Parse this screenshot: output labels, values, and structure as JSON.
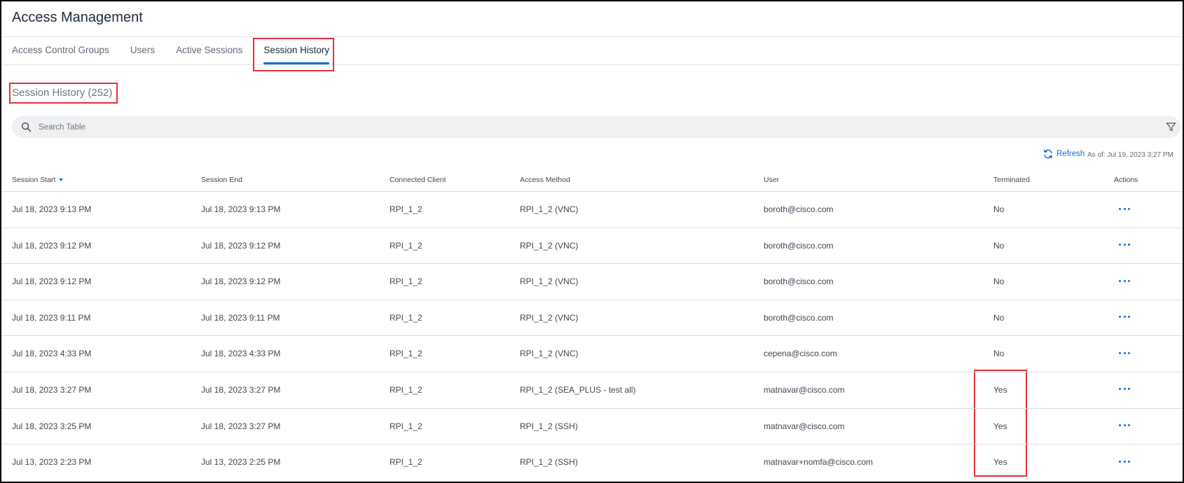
{
  "app": {
    "title": "Access Management"
  },
  "tabs": [
    {
      "label": "Access Control Groups",
      "active": false
    },
    {
      "label": "Users",
      "active": false
    },
    {
      "label": "Active Sessions",
      "active": false
    },
    {
      "label": "Session History",
      "active": true
    }
  ],
  "section": {
    "title": "Session History (252)"
  },
  "search": {
    "placeholder": "Search Table",
    "value": ""
  },
  "toolbar": {
    "refresh_label": "Refresh",
    "as_of": "As of: Jul 19, 2023 3:27 PM"
  },
  "table": {
    "columns": [
      "Session Start",
      "Session End",
      "Connected Client",
      "Access Method",
      "User",
      "Terminated",
      "Actions"
    ],
    "sort": {
      "column": "Session Start",
      "direction": "desc"
    },
    "rows": [
      {
        "session_start": "Jul 18, 2023 9:13 PM",
        "session_end": "Jul 18, 2023 9:13 PM",
        "connected_client": "RPI_1_2",
        "access_method": "RPI_1_2 (VNC)",
        "user": "boroth@cisco.com",
        "terminated": "No"
      },
      {
        "session_start": "Jul 18, 2023 9:12 PM",
        "session_end": "Jul 18, 2023 9:12 PM",
        "connected_client": "RPI_1_2",
        "access_method": "RPI_1_2 (VNC)",
        "user": "boroth@cisco.com",
        "terminated": "No"
      },
      {
        "session_start": "Jul 18, 2023 9:12 PM",
        "session_end": "Jul 18, 2023 9:12 PM",
        "connected_client": "RPI_1_2",
        "access_method": "RPI_1_2 (VNC)",
        "user": "boroth@cisco.com",
        "terminated": "No"
      },
      {
        "session_start": "Jul 18, 2023 9:11 PM",
        "session_end": "Jul 18, 2023 9:11 PM",
        "connected_client": "RPI_1_2",
        "access_method": "RPI_1_2 (VNC)",
        "user": "boroth@cisco.com",
        "terminated": "No"
      },
      {
        "session_start": "Jul 18, 2023 4:33 PM",
        "session_end": "Jul 18, 2023 4:33 PM",
        "connected_client": "RPI_1_2",
        "access_method": "RPI_1_2 (VNC)",
        "user": "cepena@cisco.com",
        "terminated": "No"
      },
      {
        "session_start": "Jul 18, 2023 3:27 PM",
        "session_end": "Jul 18, 2023 3:27 PM",
        "connected_client": "RPI_1_2",
        "access_method": "RPI_1_2 (SEA_PLUS - test all)",
        "user": "matnavar@cisco.com",
        "terminated": "Yes"
      },
      {
        "session_start": "Jul 18, 2023 3:25 PM",
        "session_end": "Jul 18, 2023 3:27 PM",
        "connected_client": "RPI_1_2",
        "access_method": "RPI_1_2 (SSH)",
        "user": "matnavar@cisco.com",
        "terminated": "Yes"
      },
      {
        "session_start": "Jul 13, 2023 2:23 PM",
        "session_end": "Jul 13, 2023 2:25 PM",
        "connected_client": "RPI_1_2",
        "access_method": "RPI_1_2 (SSH)",
        "user": "matnavar+nomfa@cisco.com",
        "terminated": "Yes"
      }
    ]
  },
  "icons": {
    "search": "search-icon",
    "filter": "filter-icon",
    "refresh": "refresh-icon",
    "row_actions": "more-horizontal-icon"
  },
  "colors": {
    "accent": "#0b6dd8",
    "highlight": "#e3313a"
  }
}
